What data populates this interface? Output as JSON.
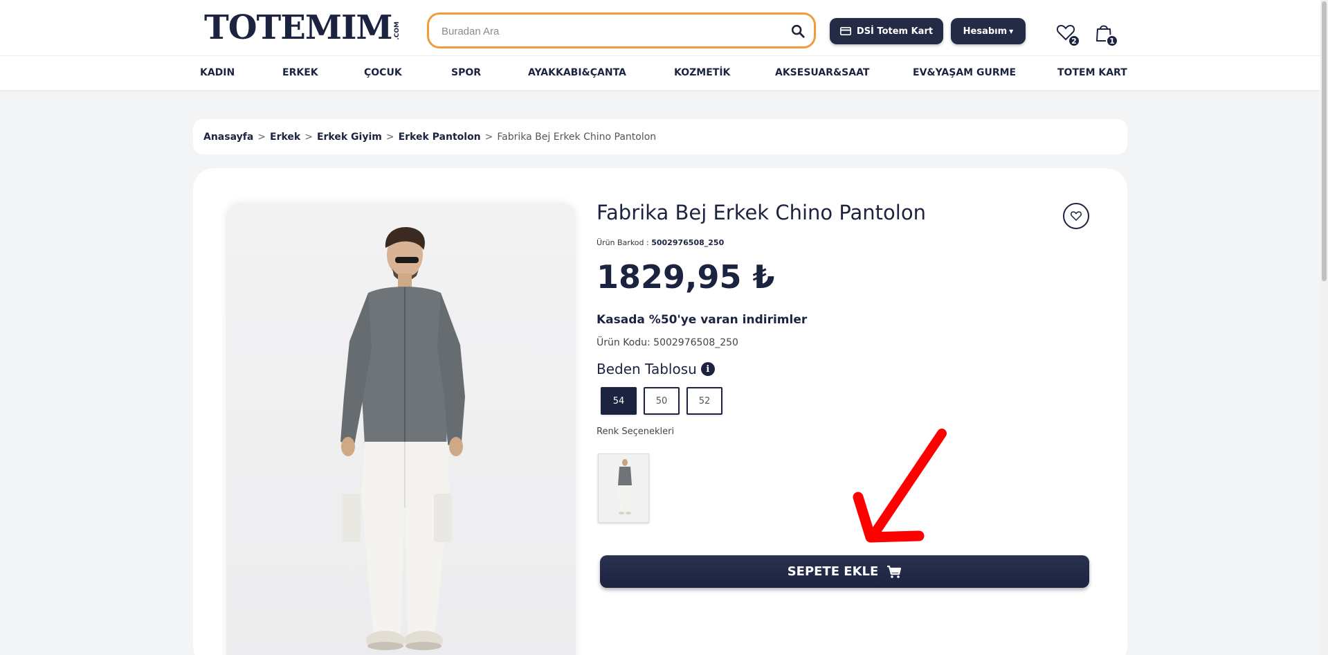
{
  "header": {
    "logo_text": "TOTEMIM",
    "logo_suffix": ".COM",
    "search_placeholder": "Buradan Ara",
    "dsi_button_label": "DSİ Totem Kart",
    "account_button_label": "Hesabım",
    "favorites_count": "2",
    "cart_count": "1"
  },
  "nav": {
    "items": [
      "KADIN",
      "ERKEK",
      "ÇOCUK",
      "SPOR",
      "AYAKKABI&ÇANTA",
      "KOZMETİK",
      "AKSESUAR&SAAT",
      "EV&YAŞAM GURME",
      "TOTEM KART"
    ]
  },
  "breadcrumb": {
    "items": [
      "Anasayfa",
      "Erkek",
      "Erkek Giyim",
      "Erkek Pantolon"
    ],
    "separator": ">",
    "current": "Fabrika Bej Erkek Chino Pantolon"
  },
  "product": {
    "title": "Fabrika Bej Erkek Chino Pantolon",
    "barcode_label": "Ürün Barkod :",
    "barcode_value": "5002976508_250",
    "price": "1829,95 ₺",
    "promo": "Kasada %50'ye varan indirimler",
    "code_text": "Ürün Kodu: 5002976508_250",
    "size_table_label": "Beden Tablosu",
    "sizes": [
      "54",
      "50",
      "52"
    ],
    "selected_size": "54",
    "color_options_label": "Renk Seçenekleri",
    "add_to_cart_label": "SEPETE EKLE"
  },
  "colors": {
    "navy": "#1c2340",
    "search_border": "#f39b3a",
    "annotation_arrow": "#ff0000"
  }
}
